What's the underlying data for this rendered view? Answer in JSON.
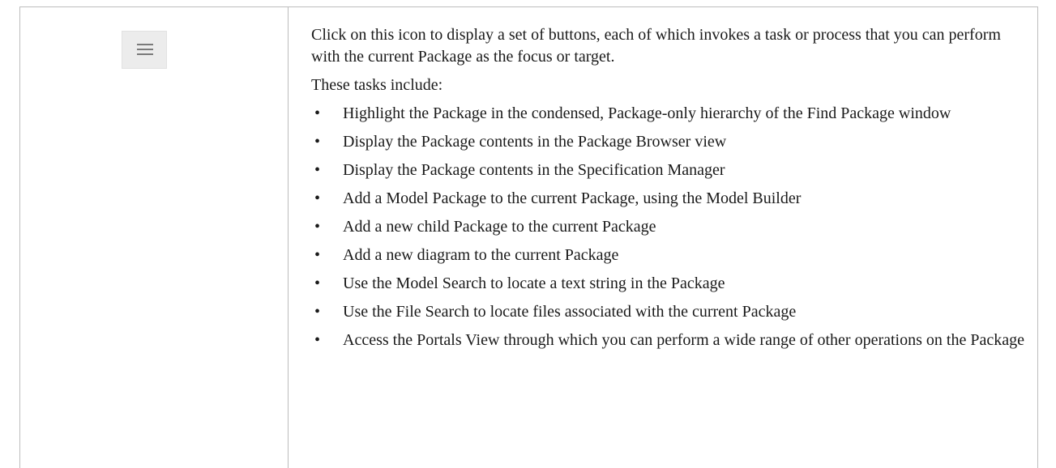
{
  "icon": {
    "name": "hamburger-menu-icon",
    "line_color": "#7a7a7a",
    "bg_color": "#ececec"
  },
  "description": {
    "intro": "Click on this icon to display a set of buttons, each of which invokes a task or process that you can perform with the current Package as the focus or target.",
    "tasks_heading": "These tasks include:",
    "bullet_char": "•",
    "tasks": [
      "Highlight the Package in the condensed, Package-only hierarchy of the Find Package window",
      "Display the Package contents in the Package Browser view",
      "Display the Package contents in the Specification Manager",
      "Add a Model Package to the current Package, using the Model Builder",
      "Add a new child Package to the current Package",
      "Add a new diagram to the current Package",
      "Use the Model Search to locate a text string in the Package",
      "Use the File Search to locate files associated with the current Package",
      "Access the Portals View through which you can perform a wide range of other operations on the Package"
    ]
  }
}
